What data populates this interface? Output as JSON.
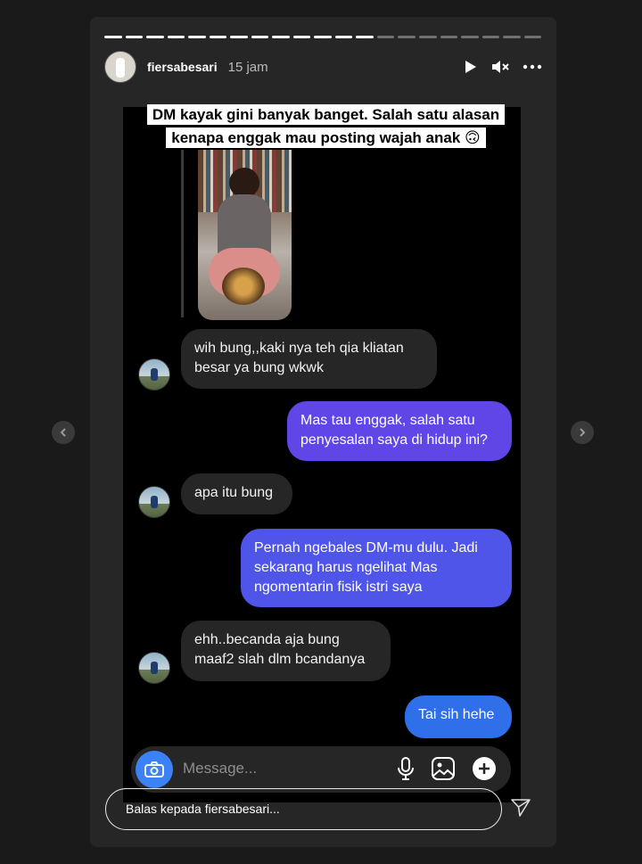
{
  "story": {
    "username": "fiersabesari",
    "time": "15 jam",
    "progress_total": 21,
    "progress_done": 13
  },
  "caption": "DM kayak gini banyak banget. Salah satu alasan kenapa enggak mau posting wajah anak 🙃",
  "messages": [
    {
      "side": "in",
      "text": "wih bung,,kaki nya teh qia kliatan\nbesar ya bung wkwk"
    },
    {
      "side": "out",
      "text": "Mas tau enggak, salah satu\npenyesalan saya di hidup ini?",
      "color": "#6046e6"
    },
    {
      "side": "in",
      "text": "apa itu bung"
    },
    {
      "side": "out",
      "text": "Pernah ngebales DM-mu dulu. Jadi\nsekarang harus ngelihat Mas\nngomentarin fisik istri saya",
      "color": "#4f55e8"
    },
    {
      "side": "in",
      "text": "ehh..becanda aja bung\nmaaf2 slah dlm bcandanya"
    },
    {
      "side": "out",
      "text": "Tai sih hehe",
      "color": "#2f6fea"
    }
  ],
  "composer": {
    "placeholder": "Message..."
  },
  "reply": {
    "placeholder": "Balas kepada fiersabesari..."
  },
  "icons": [
    "play-icon",
    "mute-icon",
    "more-icon",
    "camera-icon",
    "microphone-icon",
    "gallery-icon",
    "plus-icon",
    "send-icon",
    "chevron-left-icon",
    "chevron-right-icon"
  ]
}
